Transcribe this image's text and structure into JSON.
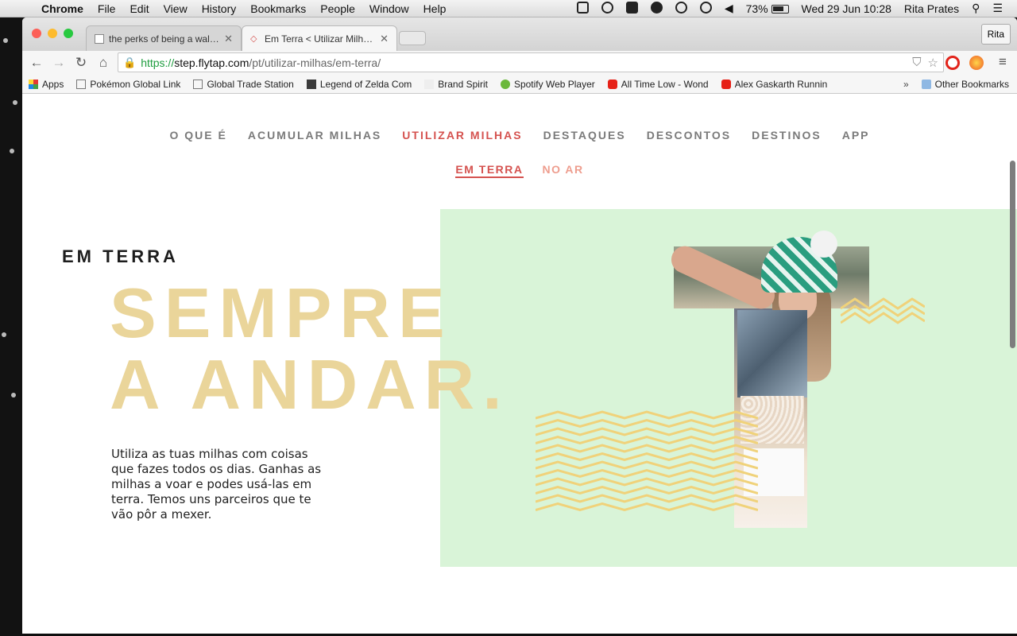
{
  "menubar": {
    "app_name": "Chrome",
    "menus": [
      "File",
      "Edit",
      "View",
      "History",
      "Bookmarks",
      "People",
      "Window",
      "Help"
    ],
    "battery": "73%",
    "datetime": "Wed 29 Jun  10:28",
    "user": "Rita Prates"
  },
  "browser": {
    "tabs": [
      {
        "title": "the perks of being a wallflo",
        "active": false
      },
      {
        "title": "Em Terra < Utilizar Milhas <",
        "active": true
      }
    ],
    "profile_button": "Rita",
    "url": {
      "scheme": "https://",
      "host": "step.flytap.com",
      "path": "/pt/utilizar-milhas/em-terra/"
    },
    "bookmarks": [
      {
        "label": "Apps",
        "icon": "apps-grid-icon"
      },
      {
        "label": "Pokémon Global Link",
        "icon": "page-icon"
      },
      {
        "label": "Global Trade Station",
        "icon": "page-icon"
      },
      {
        "label": "Legend of Zelda Com",
        "icon": "zelda-icon"
      },
      {
        "label": "Brand Spirit",
        "icon": "bs-icon"
      },
      {
        "label": "Spotify Web Player",
        "icon": "spotify-icon"
      },
      {
        "label": "All Time Low - Wond",
        "icon": "youtube-icon"
      },
      {
        "label": "Alex Gaskarth Runnin",
        "icon": "youtube-icon"
      }
    ],
    "bookmarks_overflow": "»",
    "other_bookmarks": "Other Bookmarks"
  },
  "page": {
    "main_nav": [
      "O QUE É",
      "ACUMULAR MILHAS",
      "UTILIZAR MILHAS",
      "DESTAQUES",
      "DESCONTOS",
      "DESTINOS",
      "APP"
    ],
    "main_nav_active": "UTILIZAR MILHAS",
    "sub_nav": [
      "EM TERRA",
      "NO AR"
    ],
    "sub_nav_active": "EM TERRA",
    "section_label": "EM TERRA",
    "headline_line1": "SEMPRE",
    "headline_line2": "A ANDAR.",
    "intro": "Utiliza as tuas milhas com coisas que fazes todos os dias. Ganhas as milhas a voar e podes usá-las em terra. Temos uns parceiros que te vão pôr a mexer."
  },
  "colors": {
    "accent_red": "#d5524f",
    "sub_nav_pink": "#ee9d8e",
    "panel_green": "#d9f4d8",
    "headline_sand": "#ead59a",
    "zigzag_yellow": "#f0d27a"
  }
}
